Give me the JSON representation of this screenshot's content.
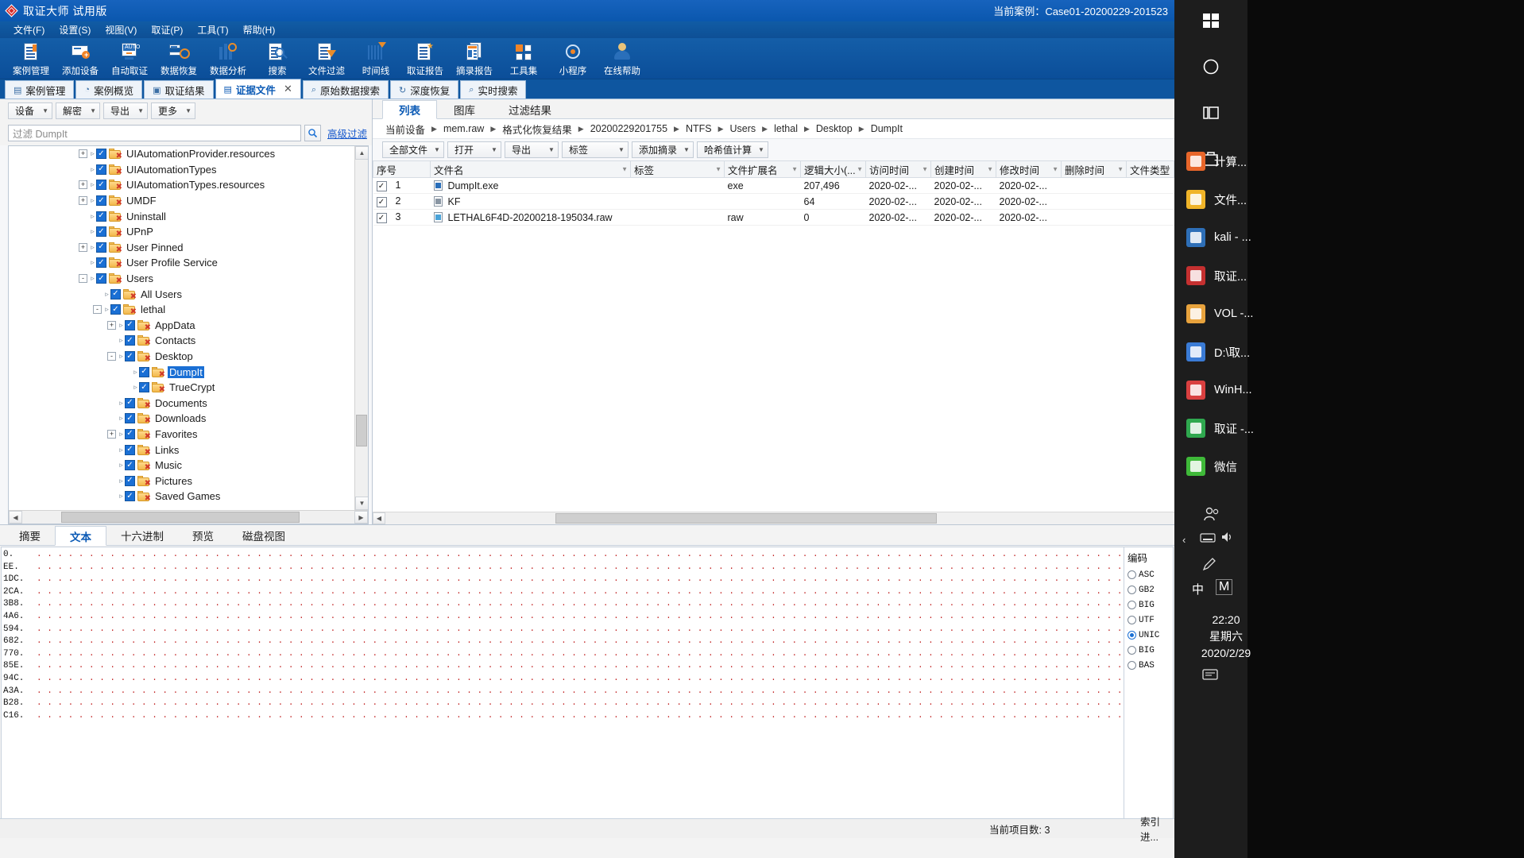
{
  "window": {
    "title": "取证大师 试用版",
    "case_label": "当前案例：",
    "case_id": "Case01-20200229-201523"
  },
  "menubar": {
    "items": [
      "文件(F)",
      "设置(S)",
      "视图(V)",
      "取证(P)",
      "工具(T)",
      "帮助(H)"
    ]
  },
  "toolbar": {
    "items": [
      {
        "label": "案例管理",
        "icon": "case-manage-icon"
      },
      {
        "label": "添加设备",
        "icon": "add-device-icon"
      },
      {
        "label": "自动取证",
        "icon": "auto-forensics-icon"
      },
      {
        "label": "数据恢复",
        "icon": "data-recovery-icon"
      },
      {
        "label": "数据分析",
        "icon": "data-analysis-icon"
      },
      {
        "label": "搜索",
        "icon": "search-icon"
      },
      {
        "label": "文件过滤",
        "icon": "file-filter-icon"
      },
      {
        "label": "时间线",
        "icon": "timeline-icon"
      },
      {
        "label": "取证报告",
        "icon": "forensics-report-icon"
      },
      {
        "label": "摘录报告",
        "icon": "excerpt-report-icon"
      },
      {
        "label": "工具集",
        "icon": "toolset-icon"
      },
      {
        "label": "小程序",
        "icon": "miniapp-icon"
      },
      {
        "label": "在线帮助",
        "icon": "online-help-icon"
      }
    ]
  },
  "page_tabs": [
    {
      "label": "案例管理",
      "icon": "case-icon",
      "active": false,
      "closable": false
    },
    {
      "label": "案例概览",
      "icon": "overview-icon",
      "active": false,
      "closable": false
    },
    {
      "label": "取证结果",
      "icon": "result-icon",
      "active": false,
      "closable": false
    },
    {
      "label": "证据文件",
      "icon": "evidence-icon",
      "active": true,
      "closable": true
    },
    {
      "label": "原始数据搜索",
      "icon": "rawsearch-icon",
      "active": false,
      "closable": false
    },
    {
      "label": "深度恢复",
      "icon": "deep-recovery-icon",
      "active": false,
      "closable": false
    },
    {
      "label": "实时搜索",
      "icon": "live-search-icon",
      "active": false,
      "closable": false
    }
  ],
  "left_pane": {
    "dropdowns": [
      "设备",
      "解密",
      "导出",
      "更多"
    ],
    "filter_placeholder": "过滤 DumpIt",
    "filter_value": "",
    "advanced_filter": "高级过滤",
    "tree": [
      {
        "label": "UIAutomationProvider.resources",
        "depth": 1,
        "expander": "+",
        "selected": false
      },
      {
        "label": "UIAutomationTypes",
        "depth": 1,
        "expander": "",
        "selected": false
      },
      {
        "label": "UIAutomationTypes.resources",
        "depth": 1,
        "expander": "+",
        "selected": false
      },
      {
        "label": "UMDF",
        "depth": 1,
        "expander": "+",
        "selected": false
      },
      {
        "label": "Uninstall",
        "depth": 1,
        "expander": "",
        "selected": false
      },
      {
        "label": "UPnP",
        "depth": 1,
        "expander": "",
        "selected": false
      },
      {
        "label": "User Pinned",
        "depth": 1,
        "expander": "+",
        "selected": false
      },
      {
        "label": "User Profile Service",
        "depth": 1,
        "expander": "",
        "selected": false
      },
      {
        "label": "Users",
        "depth": 1,
        "expander": "-",
        "selected": false
      },
      {
        "label": "All Users",
        "depth": 2,
        "expander": "",
        "selected": false
      },
      {
        "label": "lethal",
        "depth": 2,
        "expander": "-",
        "selected": false
      },
      {
        "label": "AppData",
        "depth": 3,
        "expander": "+",
        "selected": false
      },
      {
        "label": "Contacts",
        "depth": 3,
        "expander": "",
        "selected": false
      },
      {
        "label": "Desktop",
        "depth": 3,
        "expander": "-",
        "selected": false
      },
      {
        "label": "DumpIt",
        "depth": 4,
        "expander": "",
        "selected": true
      },
      {
        "label": "TrueCrypt",
        "depth": 4,
        "expander": "",
        "selected": false
      },
      {
        "label": "Documents",
        "depth": 3,
        "expander": "",
        "selected": false
      },
      {
        "label": "Downloads",
        "depth": 3,
        "expander": "",
        "selected": false
      },
      {
        "label": "Favorites",
        "depth": 3,
        "expander": "+",
        "selected": false
      },
      {
        "label": "Links",
        "depth": 3,
        "expander": "",
        "selected": false
      },
      {
        "label": "Music",
        "depth": 3,
        "expander": "",
        "selected": false
      },
      {
        "label": "Pictures",
        "depth": 3,
        "expander": "",
        "selected": false
      },
      {
        "label": "Saved Games",
        "depth": 3,
        "expander": "",
        "selected": false
      }
    ]
  },
  "right_pane": {
    "view_tabs": [
      {
        "label": "列表",
        "active": true
      },
      {
        "label": "图库",
        "active": false
      },
      {
        "label": "过滤结果",
        "active": false
      }
    ],
    "breadcrumb": [
      "当前设备",
      "mem.raw",
      "格式化恢复结果",
      "20200229201755",
      "NTFS",
      "Users",
      "lethal",
      "Desktop",
      "DumpIt"
    ],
    "toolbar": [
      "全部文件",
      "打开",
      "导出",
      "标签",
      "添加摘录",
      "哈希值计算"
    ],
    "columns": [
      "序号",
      "文件名",
      "标签",
      "文件扩展名",
      "逻辑大小(...",
      "访问时间",
      "创建时间",
      "修改时间",
      "删除时间",
      "文件类型"
    ],
    "rows": [
      {
        "checked": true,
        "no": "1",
        "name": "DumpIt.exe",
        "icon": "exe-file-icon",
        "tag": "",
        "ext": "exe",
        "size": "207,496",
        "atime": "2020-02-...",
        "ctime": "2020-02-...",
        "mtime": "2020-02-...",
        "dtime": "",
        "ftype": ""
      },
      {
        "checked": true,
        "no": "2",
        "name": "KF",
        "icon": "generic-file-icon",
        "tag": "",
        "ext": "",
        "size": "64",
        "atime": "2020-02-...",
        "ctime": "2020-02-...",
        "mtime": "2020-02-...",
        "dtime": "",
        "ftype": ""
      },
      {
        "checked": true,
        "no": "3",
        "name": "LETHAL6F4D-20200218-195034.raw",
        "icon": "raw-file-icon",
        "tag": "",
        "ext": "raw",
        "size": "0",
        "atime": "2020-02-...",
        "ctime": "2020-02-...",
        "mtime": "2020-02-...",
        "dtime": "",
        "ftype": ""
      }
    ]
  },
  "bottom_panel": {
    "tabs": [
      {
        "label": "摘要",
        "active": false
      },
      {
        "label": "文本",
        "active": true
      },
      {
        "label": "十六进制",
        "active": false
      },
      {
        "label": "预览",
        "active": false
      },
      {
        "label": "磁盘视图",
        "active": false
      }
    ],
    "offsets": [
      "0.",
      "EE.",
      "1DC.",
      "2CA.",
      "3B8.",
      "4A6.",
      "594.",
      "682.",
      "770.",
      "85E.",
      "94C.",
      "A3A.",
      "B28.",
      "C16."
    ],
    "dots_line": ". . . . . . . . . . . . . . . . . . . . . . . . . . . . . . . . . . . . . . . . . . . . . . . . . . . . . . . . . . . . . . . . . . . . . . . . . . . . . . . . . . . . . . . . . . . . . . . . . . . . . . . . . . . . . . . . . . . . . . . . . . . . . . . . . . . . . . . . . . . . . . . . . . . . .",
    "encoding_title": "编码",
    "encodings": [
      {
        "label": "ASC",
        "selected": false
      },
      {
        "label": "GB2",
        "selected": false
      },
      {
        "label": "BIG",
        "selected": false
      },
      {
        "label": "UTF",
        "selected": false
      },
      {
        "label": "UNIC",
        "selected": true
      },
      {
        "label": "BIG",
        "selected": false
      },
      {
        "label": "BAS",
        "selected": false
      }
    ]
  },
  "status_bar": {
    "item_count": "当前项目数: 3",
    "index_status": "索引进..."
  },
  "desktop": {
    "taskbar_icons": [
      "windows-start-icon",
      "search-circle-icon",
      "task-view-icon",
      "store-icon"
    ],
    "pinned": [
      {
        "label": "计算...",
        "icon": "calculator-icon",
        "color": "#e8662a"
      },
      {
        "label": "文件...",
        "icon": "file-explorer-icon",
        "color": "#f0b429"
      },
      {
        "label": "kali - ...",
        "icon": "kali-vm-icon",
        "color": "#2e6fb7"
      },
      {
        "label": "取证...",
        "icon": "forensics-app-icon",
        "color": "#c53030"
      },
      {
        "label": "VOL -...",
        "icon": "volatility-icon",
        "color": "#e8a33d"
      },
      {
        "label": "D:\\取...",
        "icon": "folder-window-icon",
        "color": "#3a7bd5"
      },
      {
        "label": "WinH...",
        "icon": "winhex-icon",
        "color": "#d94040"
      },
      {
        "label": "取证 -...",
        "icon": "forensics-master-icon",
        "color": "#2fa84f"
      },
      {
        "label": "微信",
        "icon": "wechat-icon",
        "color": "#3fb939"
      }
    ],
    "tray": {
      "people_icon": "people-icon",
      "keyboard_icon": "keyboard-icon",
      "volume_icon": "volume-icon",
      "pen_icon": "pen-icon",
      "ime_cn": "中",
      "ime_m": "M",
      "notification_icon": "notification-icon"
    },
    "clock": {
      "time": "22:20",
      "weekday": "星期六",
      "date": "2020/2/29"
    }
  }
}
